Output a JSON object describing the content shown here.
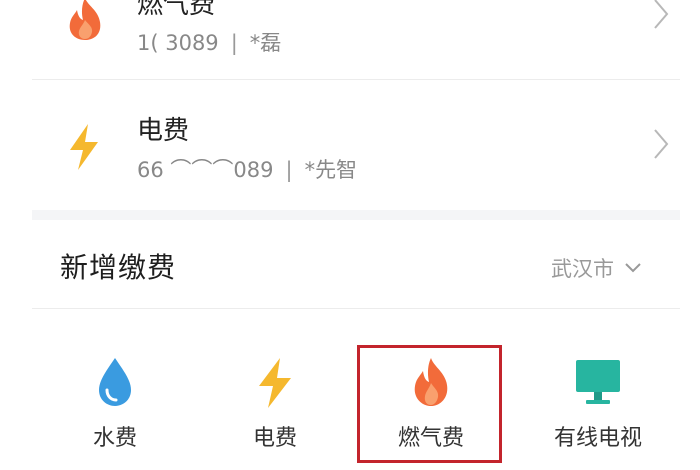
{
  "bills": [
    {
      "title": "燃气费",
      "account": "1(      3089",
      "name": "*磊",
      "icon": "flame-icon",
      "color": "#f26b3a"
    },
    {
      "title": "电费",
      "account": "66    ⌒⌒⌒089",
      "name": "*先智",
      "icon": "lightning-icon",
      "color": "#f5b82e"
    }
  ],
  "add_section": {
    "title": "新增缴费",
    "city": "武汉市"
  },
  "services": [
    {
      "label": "水费",
      "icon": "water-drop-icon",
      "color": "#3a9be0"
    },
    {
      "label": "电费",
      "icon": "lightning-icon",
      "color": "#f5b82e"
    },
    {
      "label": "燃气费",
      "icon": "flame-icon",
      "color": "#f26b3a"
    },
    {
      "label": "有线电视",
      "icon": "tv-icon",
      "color": "#27b5a0"
    }
  ],
  "highlight_color": "#c3242c"
}
